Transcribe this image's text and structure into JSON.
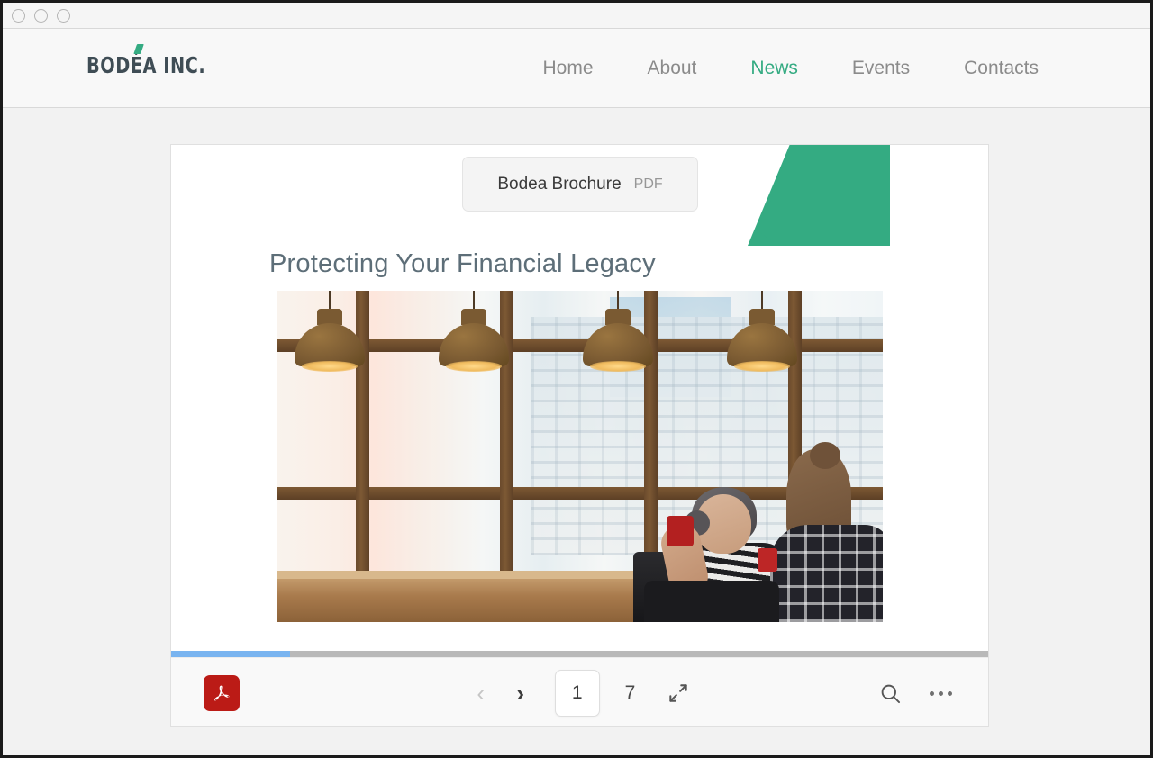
{
  "window": {
    "controls": [
      "close",
      "minimize",
      "maximize"
    ]
  },
  "site": {
    "logo_text": "BODÉA INC.",
    "accent_color": "#34ab82",
    "nav": [
      {
        "label": "Home",
        "active": false
      },
      {
        "label": "About",
        "active": false
      },
      {
        "label": "News",
        "active": true
      },
      {
        "label": "Events",
        "active": false
      },
      {
        "label": "Contacts",
        "active": false
      }
    ]
  },
  "document": {
    "file_name": "Bodea Brochure",
    "file_type": "PDF",
    "title": "Protecting Your Financial Legacy",
    "hero_image_alt": "Two people working at a cafe window counter with pendant lamps"
  },
  "viewer": {
    "progress_percent": 14.6,
    "progress_fill_color": "#79b4f0",
    "progress_track_color": "#b9b9b9",
    "app_icon": "acrobat-icon",
    "app_icon_color": "#bb1b16",
    "prev_label": "‹",
    "next_label": "›",
    "current_page": "1",
    "total_pages": "7",
    "expand_icon": "fullscreen-icon",
    "search_icon": "search-icon",
    "more_icon": "more-options-icon"
  }
}
